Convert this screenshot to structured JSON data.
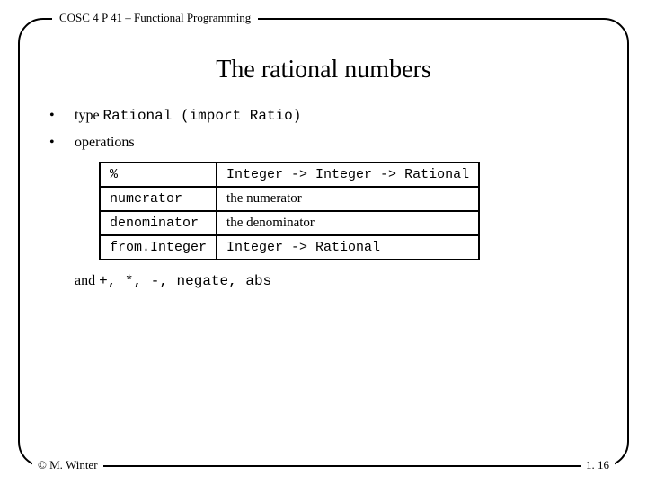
{
  "header": {
    "course": "COSC 4 P 41 – Functional Programming"
  },
  "title": "The rational numbers",
  "bullets": [
    {
      "prefix": "type ",
      "code": "Rational (import Ratio)"
    },
    {
      "prefix": "",
      "code": "",
      "plain": "operations"
    }
  ],
  "table": [
    {
      "op": "%",
      "desc": "Integer -> Integer -> Rational",
      "mono": true
    },
    {
      "op": "numerator",
      "desc": "the numerator",
      "mono": false
    },
    {
      "op": "denominator",
      "desc": "the denominator",
      "mono": false
    },
    {
      "op": "from.Integer",
      "desc": "Integer -> Rational",
      "mono": true
    }
  ],
  "and_line": {
    "lead": "and ",
    "ops": "+, *, -, negate, abs"
  },
  "footer": {
    "left": "© M. Winter",
    "right": "1. 16"
  }
}
